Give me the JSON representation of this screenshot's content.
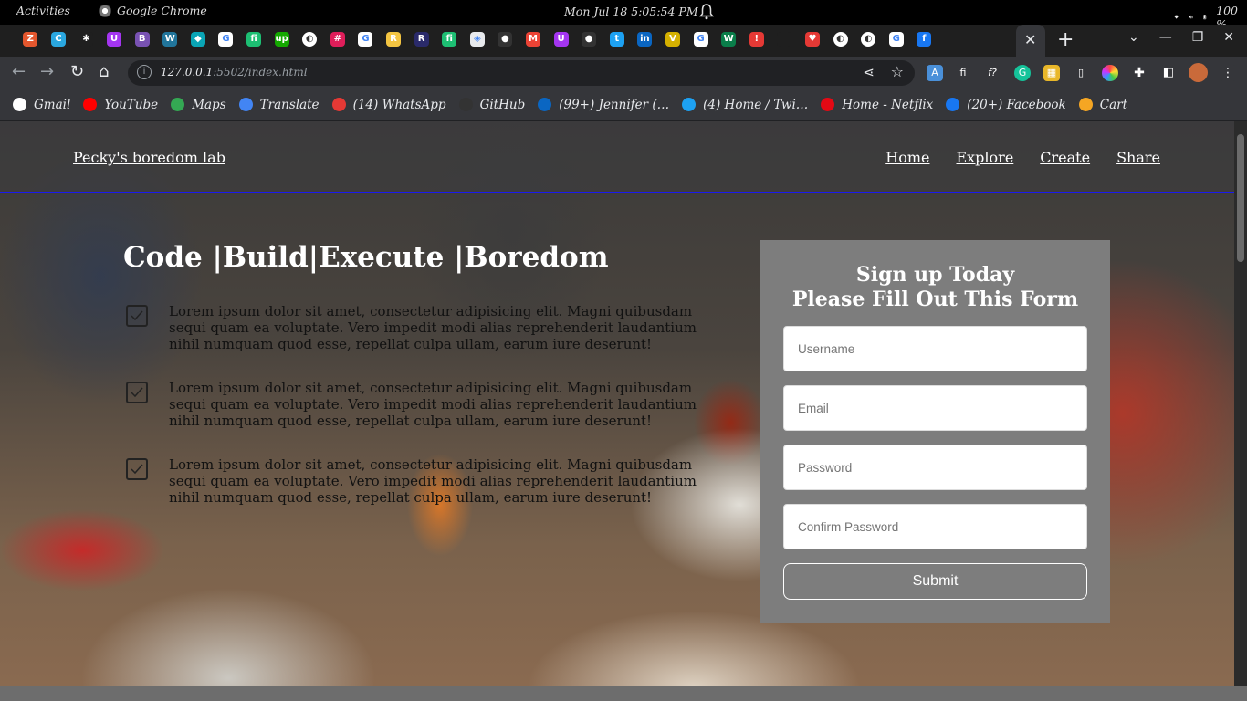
{
  "system_bar": {
    "activities": "Activities",
    "app_name": "Google Chrome",
    "clock": "Mon Jul 18   5:05:54 PM",
    "battery": "100 %"
  },
  "tabs": {
    "favicons": [
      {
        "icon": "zoho-icon",
        "color": "#e4572e",
        "glyph": "Z"
      },
      {
        "icon": "canva-icon",
        "color": "#2aa7e0",
        "glyph": "C"
      },
      {
        "icon": "asterisk-icon",
        "color": "#1f1f1f",
        "glyph": "✱"
      },
      {
        "icon": "udemy-icon",
        "color": "#a435f0",
        "glyph": "U"
      },
      {
        "icon": "bootstrap-icon",
        "color": "#7952b3",
        "glyph": "B"
      },
      {
        "icon": "wordpress-icon",
        "color": "#21759b",
        "glyph": "W"
      },
      {
        "icon": "bird-icon",
        "color": "#0aa5b5",
        "glyph": "◆"
      },
      {
        "icon": "google-icon",
        "color": "#ffffff",
        "glyph": "G"
      },
      {
        "icon": "fiverr-icon",
        "color": "#1dbf73",
        "glyph": "fi"
      },
      {
        "icon": "upwork-icon",
        "color": "#14a800",
        "glyph": "up"
      },
      {
        "icon": "globe-icon",
        "color": "#ffffff",
        "glyph": "◐"
      },
      {
        "icon": "slack-icon",
        "color": "#e01e5a",
        "glyph": "#"
      },
      {
        "icon": "google-icon",
        "color": "#ffffff",
        "glyph": "G"
      },
      {
        "icon": "r-icon",
        "color": "#f4c542",
        "glyph": "R"
      },
      {
        "icon": "r-italic-icon",
        "color": "#2a2a6a",
        "glyph": "R"
      },
      {
        "icon": "fiverr-icon",
        "color": "#1dbf73",
        "glyph": "fi"
      },
      {
        "icon": "diamond-icon",
        "color": "#e8eaed",
        "glyph": "◈"
      },
      {
        "icon": "github-icon",
        "color": "#333333",
        "glyph": "●"
      },
      {
        "icon": "gmail-icon",
        "color": "#ea4335",
        "glyph": "M"
      },
      {
        "icon": "udemy-icon",
        "color": "#a435f0",
        "glyph": "U"
      },
      {
        "icon": "github-icon",
        "color": "#333333",
        "glyph": "●"
      },
      {
        "icon": "twitter-icon",
        "color": "#1da1f2",
        "glyph": "t"
      },
      {
        "icon": "linkedin-icon",
        "color": "#0a66c2",
        "glyph": "in"
      },
      {
        "icon": "vuejs-icon",
        "color": "#d4b000",
        "glyph": "V"
      },
      {
        "icon": "google-icon",
        "color": "#ffffff",
        "glyph": "G"
      },
      {
        "icon": "w-icon",
        "color": "#0a7e4a",
        "glyph": "W"
      },
      {
        "icon": "alert-icon",
        "color": "#e53935",
        "glyph": "!"
      },
      {
        "icon": "blank-icon",
        "color": "#1f1f1f",
        "glyph": ""
      },
      {
        "icon": "heart-icon",
        "color": "#e53935",
        "glyph": "♥"
      },
      {
        "icon": "globe-icon",
        "color": "#ffffff",
        "glyph": "◐"
      },
      {
        "icon": "globe-icon",
        "color": "#ffffff",
        "glyph": "◐"
      },
      {
        "icon": "google-icon",
        "color": "#ffffff",
        "glyph": "G"
      },
      {
        "icon": "facebook-icon",
        "color": "#1877f2",
        "glyph": "f"
      }
    ],
    "active_close": "✕",
    "new_tab": "+"
  },
  "toolbar": {
    "url_host": "127.0.0.1",
    "url_path": ":5502/index.html"
  },
  "bookmarks": [
    {
      "label": "Gmail",
      "icon": "globe-icon",
      "color": "#ffffff"
    },
    {
      "label": "YouTube",
      "icon": "youtube-icon",
      "color": "#ff0000"
    },
    {
      "label": "Maps",
      "icon": "maps-icon",
      "color": "#34a853"
    },
    {
      "label": "Translate",
      "icon": "translate-icon",
      "color": "#4285f4"
    },
    {
      "label": "(14) WhatsApp",
      "icon": "alert-icon",
      "color": "#e53935"
    },
    {
      "label": "GitHub",
      "icon": "github-icon",
      "color": "#333333"
    },
    {
      "label": "(99+) Jennifer (…",
      "icon": "linkedin-icon",
      "color": "#0a66c2"
    },
    {
      "label": "(4) Home / Twi…",
      "icon": "twitter-icon",
      "color": "#1da1f2"
    },
    {
      "label": "Home - Netflix",
      "icon": "netflix-icon",
      "color": "#e50914"
    },
    {
      "label": "(20+) Facebook",
      "icon": "facebook-icon",
      "color": "#1877f2"
    },
    {
      "label": "Cart",
      "icon": "cart-icon",
      "color": "#f5a623"
    }
  ],
  "page": {
    "brand": "Pecky's boredom lab",
    "nav": [
      "Home",
      "Explore",
      "Create",
      "Share"
    ],
    "hero_title": "Code |Build|Execute |Boredom",
    "features": [
      "Lorem ipsum dolor sit amet, consectetur adipisicing elit. Magni quibusdam sequi quam ea voluptate. Vero impedit modi alias reprehenderit laudantium nihil numquam quod esse, repellat culpa ullam, earum iure deserunt!",
      "Lorem ipsum dolor sit amet, consectetur adipisicing elit. Magni quibusdam sequi quam ea voluptate. Vero impedit modi alias reprehenderit laudantium nihil numquam quod esse, repellat culpa ullam, earum iure deserunt!",
      "Lorem ipsum dolor sit amet, consectetur adipisicing elit. Magni quibusdam sequi quam ea voluptate. Vero impedit modi alias reprehenderit laudantium nihil numquam quod esse, repellat culpa ullam, earum iure deserunt!"
    ],
    "form": {
      "title_line1": "Sign up Today",
      "title_line2": "Please Fill Out This Form",
      "username_placeholder": "Username",
      "email_placeholder": "Email",
      "password_placeholder": "Password",
      "confirm_placeholder": "Confirm Password",
      "submit": "Submit"
    }
  },
  "colors": {
    "header_border": "#1a1aee",
    "form_panel": "#7d7d7d"
  }
}
